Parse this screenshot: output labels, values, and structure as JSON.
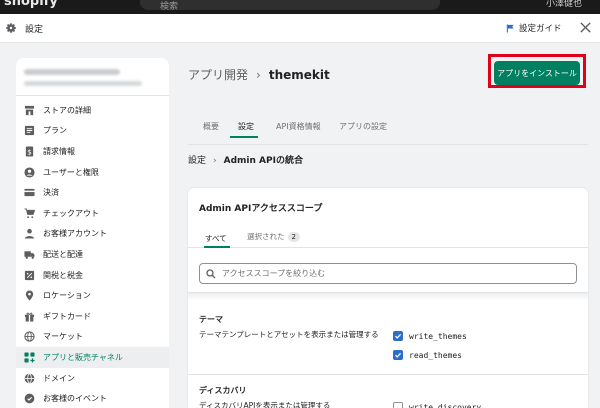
{
  "topbar": {
    "brand": "shopify",
    "search_placeholder": "検索",
    "user": "小澤健也"
  },
  "header": {
    "title": "設定",
    "guide_label": "設定ガイド"
  },
  "sidebar": {
    "items": [
      {
        "label": "ストアの詳細",
        "icon": "store-icon"
      },
      {
        "label": "プラン",
        "icon": "plan-icon"
      },
      {
        "label": "請求情報",
        "icon": "billing-icon"
      },
      {
        "label": "ユーザーと権限",
        "icon": "user-icon"
      },
      {
        "label": "決済",
        "icon": "payment-icon"
      },
      {
        "label": "チェックアウト",
        "icon": "cart-icon"
      },
      {
        "label": "お客様アカウント",
        "icon": "account-icon"
      },
      {
        "label": "配送と配達",
        "icon": "truck-icon"
      },
      {
        "label": "関税と税金",
        "icon": "tax-icon"
      },
      {
        "label": "ロケーション",
        "icon": "location-icon"
      },
      {
        "label": "ギフトカード",
        "icon": "gift-icon"
      },
      {
        "label": "マーケット",
        "icon": "globe-icon"
      },
      {
        "label": "アプリと販売チャネル",
        "icon": "apps-icon",
        "active": true
      },
      {
        "label": "ドメイン",
        "icon": "domain-icon"
      },
      {
        "label": "お客様のイベント",
        "icon": "event-icon"
      }
    ]
  },
  "main": {
    "breadcrumb_parent": "アプリ開発",
    "breadcrumb_current": "themekit",
    "install_button": "アプリをインストール",
    "tabs": [
      "概要",
      "設定",
      "API資格情報",
      "アプリの設定"
    ],
    "sub_breadcrumb_parent": "設定",
    "sub_breadcrumb_current": "Admin APIの統合"
  },
  "card": {
    "title": "Admin APIアクセススコープ",
    "tab_all": "すべて",
    "tab_selected": "選択された",
    "selected_count": "2",
    "search_placeholder": "アクセススコープを絞り込む",
    "sections": [
      {
        "title": "テーマ",
        "description": "テーマテンプレートとアセットを表示または管理する",
        "permissions": [
          {
            "name": "write_themes",
            "checked": true
          },
          {
            "name": "read_themes",
            "checked": true
          }
        ]
      },
      {
        "title": "ディスカバリ",
        "description": "ディスカバリAPIを表示または管理する",
        "permissions": [
          {
            "name": "write_discovery",
            "checked": false
          }
        ]
      }
    ]
  },
  "colors": {
    "accent": "#008060",
    "checkbox": "#2c6ecb",
    "highlight": "#e0001a"
  }
}
